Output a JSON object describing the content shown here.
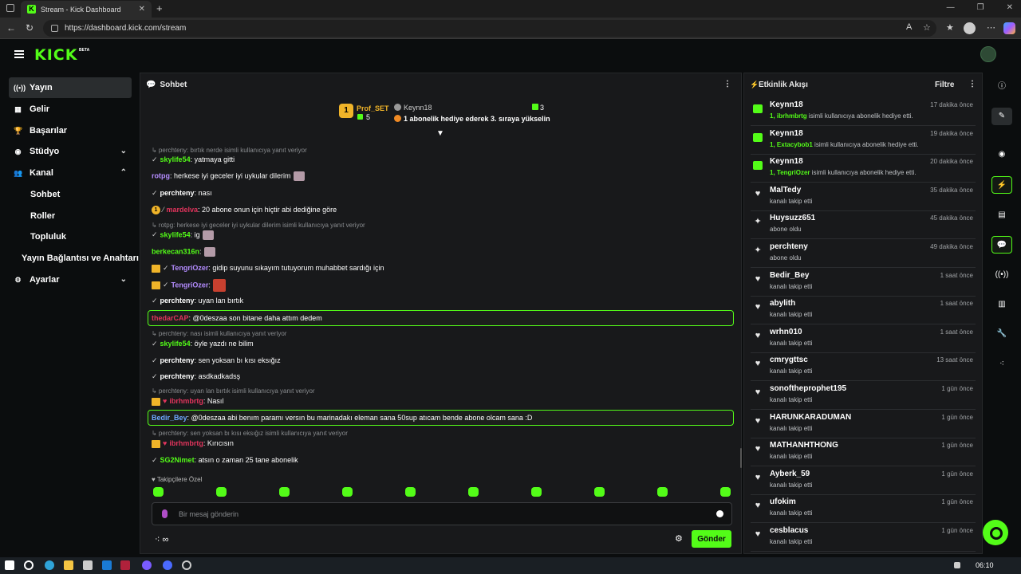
{
  "browser": {
    "tab_title": "Stream - Kick Dashboard",
    "url": "https://dashboard.kick.com/stream"
  },
  "header": {
    "logo": "KICK",
    "beta": "BETA"
  },
  "sidebar": {
    "items": [
      {
        "label": "Yayın",
        "icon": "broadcast-icon"
      },
      {
        "label": "Gelir",
        "icon": "chart-icon"
      },
      {
        "label": "Başarılar",
        "icon": "trophy-icon"
      },
      {
        "label": "Stüdyo",
        "icon": "camera-icon"
      },
      {
        "label": "Kanal",
        "icon": "user-group-icon"
      },
      {
        "label": "Sohbet"
      },
      {
        "label": "Roller"
      },
      {
        "label": "Topluluk"
      },
      {
        "label": "Yayın Bağlantısı ve Anahtarı"
      },
      {
        "label": "Ayarlar",
        "icon": "gear-icon"
      }
    ]
  },
  "chat": {
    "title": "Sohbet",
    "pinned": {
      "rank": "1",
      "leader_name": "Prof_SET",
      "leader_count": "5",
      "gifter": "Keynn18",
      "gift_count": "3",
      "gift_message": "1 abonelik hediye ederek 3. sıraya yükselin"
    },
    "messages": [
      {
        "reply": "↳ perchteny: bırtık nerde isimli kullanıcıya yanıt veriyor"
      },
      {
        "user": "skylife54",
        "text": ": yatmaya gitti"
      },
      {
        "user": "rotpg",
        "text": ": herkese iyi geceler iyi uykular dilerim"
      },
      {
        "user": "perchteny",
        "text": ": nası"
      },
      {
        "user": "mardelva",
        "text": ": 20 abone onun için hiçtir abi dediğine göre"
      },
      {
        "reply": "↳ rotpg: herkese iyi geceler iyi uykular dilerim  isimli kullanıcıya yanıt veriyor"
      },
      {
        "user": "skylife54",
        "text": ": ig"
      },
      {
        "user": "berkecan316n",
        "text": ":"
      },
      {
        "user": "TengriOzer",
        "text": ": gidip suyunu sıkayım tutuyorum muhabbet sardığı için"
      },
      {
        "user": "TengriOzer",
        "text": ":"
      },
      {
        "user": "perchteny",
        "text": ": uyan lan bırtık"
      },
      {
        "user": "thedarCAP",
        "text": ": @0deszaa son bitane daha attım dedem"
      },
      {
        "reply": "↳ perchteny: nası isimli kullanıcıya yanıt veriyor"
      },
      {
        "user": "skylife54",
        "text": ": öyle yazdı ne bilim"
      },
      {
        "user": "perchteny",
        "text": ": sen yoksan bı kısı eksığız"
      },
      {
        "user": "perchteny",
        "text": ": asdkadkadsş"
      },
      {
        "reply": "↳ perchteny: uyan lan bırtık isimli kullanıcıya yanıt veriyor"
      },
      {
        "user": "ibrhmbrtg",
        "text": ": Nasıl"
      },
      {
        "user": "Bedir_Bey",
        "text": ": @0deszaa abi benım paramı versın bu marinadakı eleman sana 50sup atıcam bende abone olcam sana :D"
      },
      {
        "reply": "↳ perchteny: sen yoksan bı kısı eksığız isimli kullanıcıya yanıt veriyor"
      },
      {
        "user": "ibrhmbrtg",
        "text": ": Kırıcısın"
      },
      {
        "user": "SG2Nimet",
        "text": ": atsın o zaman 25 tane abonelik"
      }
    ],
    "followers_only": "♥ Takipçilere Özel",
    "input_placeholder": "Bir mesaj gönderin",
    "send_label": "Gönder"
  },
  "events": {
    "title": "Etkinlik Akışı",
    "filter_label": "Filtre",
    "items": [
      {
        "name": "Keynn18",
        "time": "17 dakika önce",
        "count": "1, ",
        "target": "ibrhmbrtg",
        "desc": " isimli kullanıcıya abonelik hediye etti.",
        "type": "gift"
      },
      {
        "name": "Keynn18",
        "time": "19 dakika önce",
        "count": "1, ",
        "target": "Extacybob1",
        "desc": " isimli kullanıcıya abonelik hediye etti.",
        "type": "gift"
      },
      {
        "name": "Keynn18",
        "time": "20 dakika önce",
        "count": "1, ",
        "target": "TengriOzer",
        "desc": " isimli kullanıcıya abonelik hediye etti.",
        "type": "gift"
      },
      {
        "name": "MalTedy",
        "time": "35 dakika önce",
        "desc": "kanalı takip etti",
        "type": "follow"
      },
      {
        "name": "Huysuzz651",
        "time": "45 dakika önce",
        "desc": "abone oldu",
        "type": "sub"
      },
      {
        "name": "perchteny",
        "time": "49 dakika önce",
        "desc": "abone oldu",
        "type": "sub"
      },
      {
        "name": "Bedir_Bey",
        "time": "1 saat önce",
        "desc": "kanalı takip etti",
        "type": "follow"
      },
      {
        "name": "abylith",
        "time": "1 saat önce",
        "desc": "kanalı takip etti",
        "type": "follow"
      },
      {
        "name": "wrhn010",
        "time": "1 saat önce",
        "desc": "kanalı takip etti",
        "type": "follow"
      },
      {
        "name": "cmrygttsc",
        "time": "13 saat önce",
        "desc": "kanalı takip etti",
        "type": "follow"
      },
      {
        "name": "sonoftheprophet195",
        "time": "1 gün önce",
        "desc": "kanalı takip etti",
        "type": "follow"
      },
      {
        "name": "HARUNKARADUMAN",
        "time": "1 gün önce",
        "desc": "kanalı takip etti",
        "type": "follow"
      },
      {
        "name": "MATHANHTHONG",
        "time": "1 gün önce",
        "desc": "kanalı takip etti",
        "type": "follow"
      },
      {
        "name": "Ayberk_59",
        "time": "1 gün önce",
        "desc": "kanalı takip etti",
        "type": "follow"
      },
      {
        "name": "ufokim",
        "time": "1 gün önce",
        "desc": "kanalı takip etti",
        "type": "follow"
      },
      {
        "name": "cesblacus",
        "time": "1 gün önce",
        "desc": "kanalı takip etti",
        "type": "follow"
      }
    ]
  },
  "taskbar": {
    "clock": "06:10"
  },
  "colors": {
    "accent": "#53fc18",
    "panel": "#18191b",
    "bg": "#0b0d0e"
  }
}
